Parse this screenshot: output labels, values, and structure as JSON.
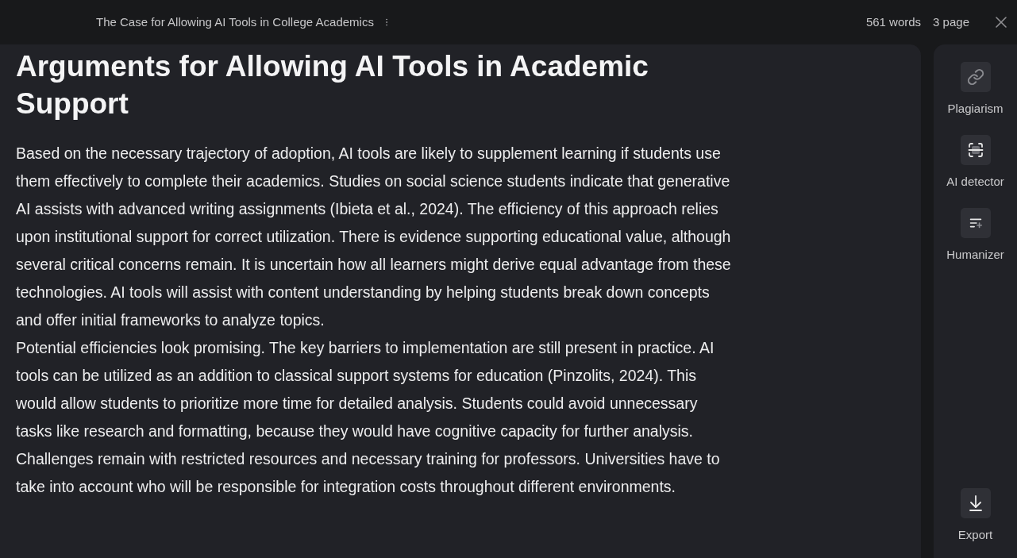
{
  "document": {
    "title": "The Case for Allowing AI Tools in College Academics",
    "word_count": "561 words",
    "page_count": "3 page"
  },
  "editor": {
    "heading": "Arguments for Allowing AI Tools in Academic Support",
    "paragraphs": [
      "Based on the necessary trajectory of adoption, AI tools are likely to supplement learning if students use them effectively to complete their academics. Studies on social science students indicate that generative AI assists with advanced writing assignments (Ibieta et al., 2024). The efficiency of this approach relies upon institutional support for correct utilization. There is evidence supporting educational value, although several critical concerns remain. It is uncertain how all learners might derive equal advantage from these technologies. AI tools will assist with content understanding by helping students break down concepts and offer initial frameworks to analyze topics.",
      "Potential efficiencies look promising. The key barriers to implementation are still present in practice. AI tools can be utilized as an addition to classical support systems for education (Pinzolits, 2024). This would allow students to prioritize more time for detailed analysis. Students could avoid unnecessary tasks like research and formatting, because they would have cognitive capacity for further analysis. Challenges remain with restricted resources and necessary training for professors. Universities have to take into account who will be responsible for integration costs throughout different environments."
    ]
  },
  "tools": [
    {
      "kind": "plagiarism",
      "label": "Plagiarism"
    },
    {
      "kind": "detector",
      "label": "AI detector"
    },
    {
      "kind": "humanizer",
      "label": "Humanizer"
    }
  ],
  "bottom_tools": [
    {
      "kind": "export",
      "label": "Export"
    }
  ]
}
